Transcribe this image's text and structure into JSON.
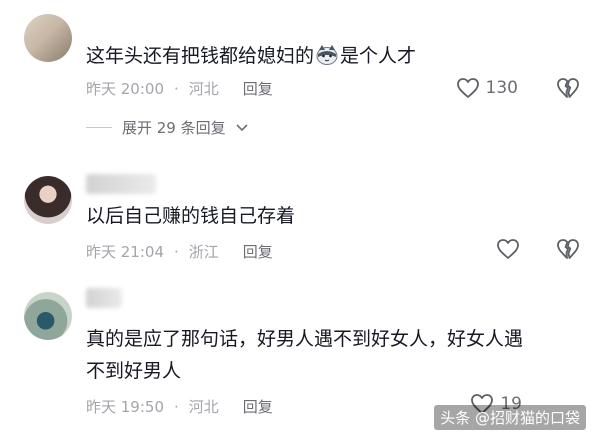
{
  "comments": [
    {
      "text_before_emoji": "这年头还有把钱都给媳妇的",
      "emoji": "cat-emoji",
      "text_after_emoji": "是个人才",
      "time": "昨天 20:00",
      "location": "河北",
      "reply_label": "回复",
      "likes": "130",
      "expand_label": "展开 29 条回复"
    },
    {
      "text": "以后自己赚的钱自己存着",
      "time": "昨天 21:04",
      "location": "浙江",
      "reply_label": "回复"
    },
    {
      "text_line1": "真的是应了那句话，好男人遇不到好女人，好女人遇",
      "text_line2": "不到好男人",
      "time": "昨天 19:50",
      "location": "河北",
      "reply_label": "回复",
      "likes": "19"
    }
  ],
  "separator": "·",
  "watermark": "头条 @招财猫的口袋",
  "icons": {
    "like": "heart-outline-icon",
    "dislike": "broken-heart-icon",
    "expand": "chevron-down-icon"
  },
  "colors": {
    "text": "#161823",
    "meta": "#a3a5ab",
    "secondary": "#6b6d73"
  }
}
